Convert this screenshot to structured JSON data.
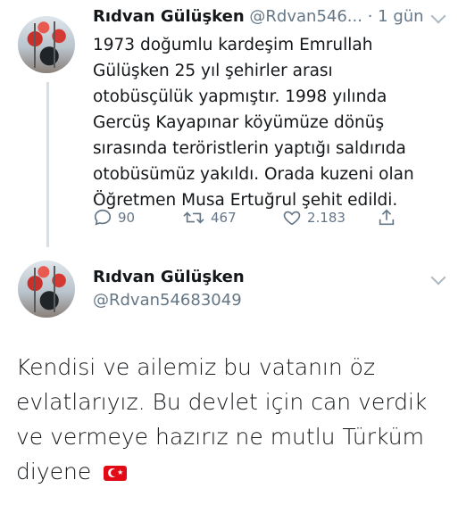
{
  "tweet1": {
    "author_name": "Rıdvan Gülüşken",
    "author_handle": "@Rdvan546...",
    "separator": "·",
    "time": "1 gün",
    "text": "1973 doğumlu kardeşim Emrullah Gülüşken 25 yıl şehirler arası otobüsçülük yapmıştır. 1998 yılında Gercüş Kayapınar köyümüze dönüş sırasında teröristlerin yaptığı saldırıda otobüsümüz yakıldı. Orada kuzeni olan Öğretmen Musa Ertuğrul şehit edildi.",
    "reply_count": "90",
    "retweet_count": "467",
    "like_count": "2.183"
  },
  "tweet2": {
    "author_name": "Rıdvan Gülüşken",
    "author_handle": "@Rdvan54683049",
    "text": "Kendisi ve ailemiz bu vatanın öz evlatlarıyız. Bu devlet için can verdik ve vermeye hazırız ne mutlu Türküm diyene"
  },
  "icons": {
    "reply": "reply-icon",
    "retweet": "retweet-icon",
    "like": "heart-icon",
    "share": "share-icon",
    "menu": "chevron-down-icon",
    "flag": "turkey-flag-icon"
  },
  "colors": {
    "text": "#14171a",
    "secondary": "#657786",
    "flag_red": "#e30a17"
  }
}
